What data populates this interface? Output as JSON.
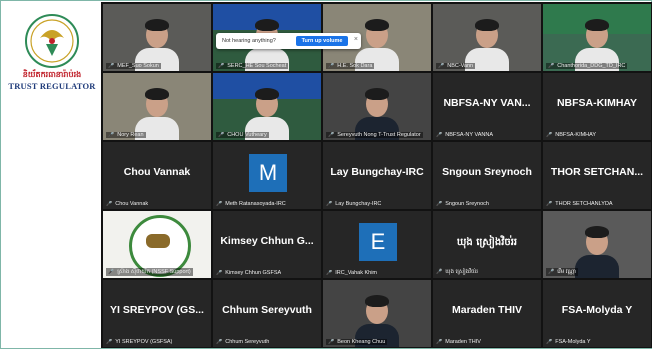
{
  "logo": {
    "title_kh": "និយ័តករធានារ៉ាប់រង",
    "title_en": "TRUST REGULATOR"
  },
  "banner": {
    "text": "Not hearing anything?",
    "button": "Turn up volume",
    "close": "×"
  },
  "tiles": [
    {
      "kind": "video",
      "label": "MEF_Suo Sokun",
      "scene": "office"
    },
    {
      "kind": "video",
      "label": "SERC_HE Sou Socheat",
      "scene": "emblem"
    },
    {
      "kind": "video",
      "label": "H.E. Sok Dara",
      "scene": "office-light"
    },
    {
      "kind": "video",
      "label": "NBC-Vann",
      "scene": "office"
    },
    {
      "kind": "video",
      "label": "Chanthorida_DDG_TD_IRC",
      "scene": "irc"
    },
    {
      "kind": "video",
      "label": "Nory Rean",
      "scene": "office-light"
    },
    {
      "kind": "video",
      "label": "CHOU Vutheary",
      "scene": "emblem"
    },
    {
      "kind": "video",
      "label": "Sereyvuth Nong T-Trust Regulator",
      "scene": "portrait"
    },
    {
      "kind": "name",
      "name": "NBFSA-NY VAN...",
      "label": "NBFSA-NY VANNA"
    },
    {
      "kind": "name",
      "name": "NBFSA-KIMHAY",
      "label": "NBFSA-KIMHAY"
    },
    {
      "kind": "name",
      "name": "Chou Vannak",
      "label": "Chou Vannak"
    },
    {
      "kind": "avatar",
      "letter": "M",
      "color": "#1e6fb8",
      "label": "Meth Ratanasoyada-IRC"
    },
    {
      "kind": "name",
      "name": "Lay Bungchay-IRC",
      "label": "Lay Bungchay-IRC"
    },
    {
      "kind": "name",
      "name": "Sngoun Sreynoch",
      "label": "Sngoun Sreynoch"
    },
    {
      "kind": "name",
      "name": "THOR SETCHAN...",
      "label": "THOR SETCHANLYDA"
    },
    {
      "kind": "video",
      "label": "ស្រ៊ាង ស៊ីថាយ័ក (NSSF Support)",
      "scene": "fsa-logo"
    },
    {
      "kind": "name",
      "name": "Kimsey Chhun G...",
      "label": "Kimsey Chhun GSFSA"
    },
    {
      "kind": "avatar",
      "letter": "E",
      "color": "#1e6fb8",
      "label": "IRC_Vahak Khim"
    },
    {
      "kind": "name",
      "name": "ឃុង ស្រៀងវិចរ់រ",
      "label": "ឃុង ស្រៀងវិចរ់រ",
      "kh": true
    },
    {
      "kind": "video",
      "label": "វើម វណ្ណា",
      "scene": "suit-portrait"
    },
    {
      "kind": "name",
      "name": "YI SREYPOV (GS...",
      "label": "YI SREYPOV (GSFSA)"
    },
    {
      "kind": "name",
      "name": "Chhum Sereyvuth",
      "label": "Chhum Sereyvuth"
    },
    {
      "kind": "video",
      "label": "Beon Kheang Chuu",
      "scene": "portrait"
    },
    {
      "kind": "name",
      "name": "Maraden THIV",
      "label": "Maraden THIV"
    },
    {
      "kind": "name",
      "name": "FSA-Molyda Y",
      "label": "FSA-Molyda Y"
    }
  ]
}
